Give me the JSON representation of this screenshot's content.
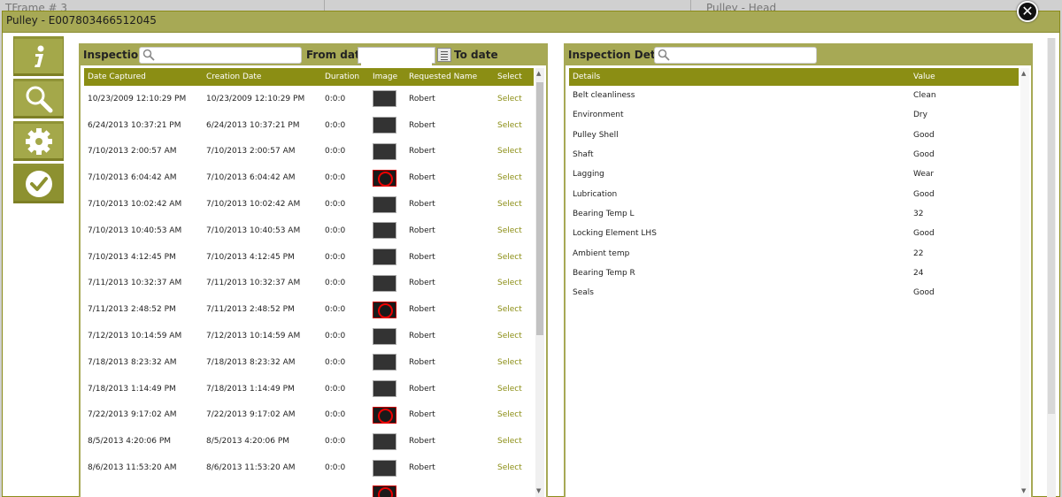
{
  "background": {
    "left_label": "TFrame #  3",
    "right_label": "Pulley - Head"
  },
  "modal": {
    "title": "Pulley - E007803466512045",
    "close_icon": "close-icon"
  },
  "toolbar": {
    "items": [
      {
        "icon": "info-icon"
      },
      {
        "icon": "search-icon"
      },
      {
        "icon": "gear-icon"
      },
      {
        "icon": "check-icon"
      }
    ]
  },
  "inspections": {
    "title": "Inspections",
    "search_placeholder": "",
    "from_date_label": "From date",
    "from_date_value": "",
    "to_date_label": "To date",
    "columns": [
      "Date Captured",
      "Creation Date",
      "Duration",
      "Image",
      "Requested Name",
      "Select"
    ],
    "rows": [
      {
        "captured": "10/23/2009 12:10:29 PM",
        "created": "10/23/2009 12:10:29 PM",
        "duration": "0:0:0",
        "image": "photo",
        "name": "Robert",
        "select": "Select"
      },
      {
        "captured": "6/24/2013 10:37:21 PM",
        "created": "6/24/2013 10:37:21 PM",
        "duration": "0:0:0",
        "image": "photo",
        "name": "Robert",
        "select": "Select"
      },
      {
        "captured": "7/10/2013 2:00:57 AM",
        "created": "7/10/2013 2:00:57 AM",
        "duration": "0:0:0",
        "image": "photo",
        "name": "Robert",
        "select": "Select"
      },
      {
        "captured": "7/10/2013 6:04:42 AM",
        "created": "7/10/2013 6:04:42 AM",
        "duration": "0:0:0",
        "image": "no-image",
        "name": "Robert",
        "select": "Select"
      },
      {
        "captured": "7/10/2013 10:02:42 AM",
        "created": "7/10/2013 10:02:42 AM",
        "duration": "0:0:0",
        "image": "photo",
        "name": "Robert",
        "select": "Select"
      },
      {
        "captured": "7/10/2013 10:40:53 AM",
        "created": "7/10/2013 10:40:53 AM",
        "duration": "0:0:0",
        "image": "photo",
        "name": "Robert",
        "select": "Select"
      },
      {
        "captured": "7/10/2013 4:12:45 PM",
        "created": "7/10/2013 4:12:45 PM",
        "duration": "0:0:0",
        "image": "photo",
        "name": "Robert",
        "select": "Select"
      },
      {
        "captured": "7/11/2013 10:32:37 AM",
        "created": "7/11/2013 10:32:37 AM",
        "duration": "0:0:0",
        "image": "photo",
        "name": "Robert",
        "select": "Select"
      },
      {
        "captured": "7/11/2013 2:48:52 PM",
        "created": "7/11/2013 2:48:52 PM",
        "duration": "0:0:0",
        "image": "no-image",
        "name": "Robert",
        "select": "Select"
      },
      {
        "captured": "7/12/2013 10:14:59 AM",
        "created": "7/12/2013 10:14:59 AM",
        "duration": "0:0:0",
        "image": "photo",
        "name": "Robert",
        "select": "Select"
      },
      {
        "captured": "7/18/2013 8:23:32 AM",
        "created": "7/18/2013 8:23:32 AM",
        "duration": "0:0:0",
        "image": "photo",
        "name": "Robert",
        "select": "Select"
      },
      {
        "captured": "7/18/2013 1:14:49 PM",
        "created": "7/18/2013 1:14:49 PM",
        "duration": "0:0:0",
        "image": "photo",
        "name": "Robert",
        "select": "Select"
      },
      {
        "captured": "7/22/2013 9:17:02 AM",
        "created": "7/22/2013 9:17:02 AM",
        "duration": "0:0:0",
        "image": "no-image",
        "name": "Robert",
        "select": "Select"
      },
      {
        "captured": "8/5/2013 4:20:06 PM",
        "created": "8/5/2013 4:20:06 PM",
        "duration": "0:0:0",
        "image": "photo",
        "name": "Robert",
        "select": "Select"
      },
      {
        "captured": "8/6/2013 11:53:20 AM",
        "created": "8/6/2013 11:53:20 AM",
        "duration": "0:0:0",
        "image": "photo",
        "name": "Robert",
        "select": "Select"
      }
    ]
  },
  "details": {
    "title": "Inspection Details",
    "search_placeholder": "",
    "columns": [
      "Details",
      "Value"
    ],
    "rows": [
      {
        "detail": "Belt cleanliness",
        "value": "Clean"
      },
      {
        "detail": "Environment",
        "value": "Dry"
      },
      {
        "detail": "Pulley Shell",
        "value": "Good"
      },
      {
        "detail": "Shaft",
        "value": "Good"
      },
      {
        "detail": "Lagging",
        "value": "Wear"
      },
      {
        "detail": "Lubrication",
        "value": "Good"
      },
      {
        "detail": "Bearing Temp L",
        "value": "32"
      },
      {
        "detail": "Locking Element LHS",
        "value": "Good"
      },
      {
        "detail": "Ambient temp",
        "value": "22"
      },
      {
        "detail": "Bearing Temp R",
        "value": "24"
      },
      {
        "detail": "Seals",
        "value": "Good"
      }
    ]
  },
  "colors": {
    "header_olive": "#a7a955",
    "table_header": "#8b8e14",
    "select_link": "#8b8e14"
  }
}
